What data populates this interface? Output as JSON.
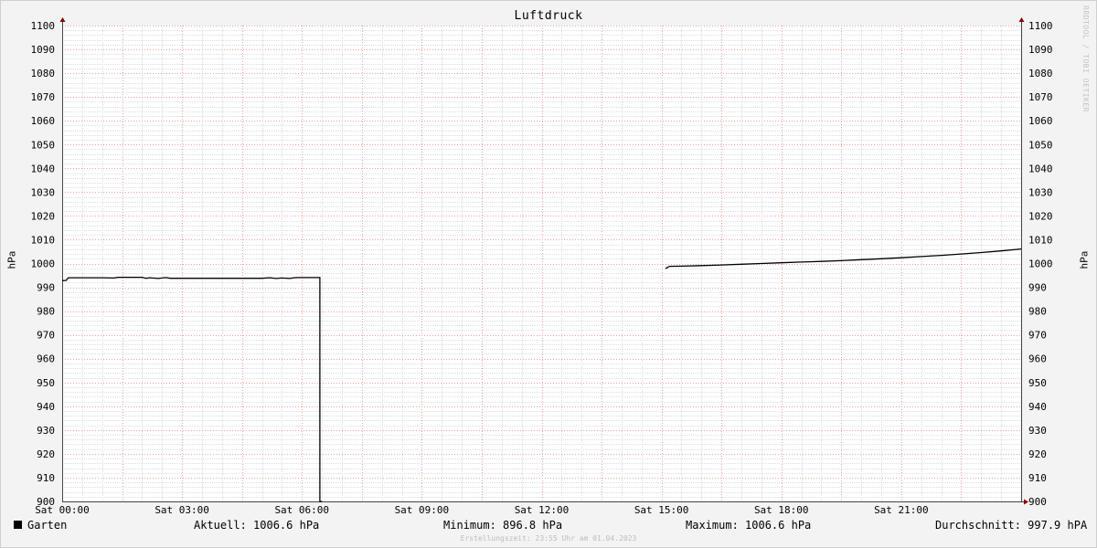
{
  "watermark": "RRDTOOL / TOBI OETIKER",
  "chart_data": {
    "type": "line",
    "title": "Luftdruck",
    "ylabel": "hPa",
    "ylim": [
      900,
      1100
    ],
    "ytick_labels": [
      "900",
      "910",
      "920",
      "930",
      "940",
      "950",
      "960",
      "970",
      "980",
      "990",
      "1000",
      "1010",
      "1020",
      "1030",
      "1040",
      "1050",
      "1060",
      "1070",
      "1080",
      "1090",
      "1100"
    ],
    "xlim": [
      0,
      24
    ],
    "xtick_labels": [
      "Sat 00:00",
      "Sat 03:00",
      "Sat 06:00",
      "Sat 09:00",
      "Sat 12:00",
      "Sat 15:00",
      "Sat 18:00",
      "Sat 21:00"
    ],
    "xtick_values": [
      0,
      3,
      6,
      9,
      12,
      15,
      18,
      21
    ],
    "grid": true,
    "series": [
      {
        "name": "Garten",
        "color": "#000000",
        "segments": [
          [
            [
              0.0,
              992.8
            ],
            [
              0.1,
              992.9
            ],
            [
              0.15,
              994.0
            ],
            [
              1.0,
              994.0
            ],
            [
              1.3,
              993.9
            ],
            [
              1.4,
              994.2
            ],
            [
              2.0,
              994.2
            ],
            [
              2.1,
              993.8
            ],
            [
              2.2,
              994.0
            ],
            [
              2.4,
              993.7
            ],
            [
              2.6,
              994.1
            ],
            [
              2.7,
              993.8
            ],
            [
              3.0,
              993.8
            ],
            [
              4.0,
              993.8
            ],
            [
              5.0,
              993.8
            ],
            [
              5.2,
              994.0
            ],
            [
              5.35,
              993.7
            ],
            [
              5.5,
              993.9
            ],
            [
              5.7,
              993.7
            ],
            [
              5.8,
              994.0
            ],
            [
              5.9,
              994.1
            ],
            [
              6.45,
              994.1
            ],
            [
              6.45,
              900.0
            ],
            [
              6.5,
              900.0
            ]
          ],
          [
            [
              15.1,
              997.9
            ],
            [
              15.2,
              998.8
            ],
            [
              15.5,
              998.9
            ],
            [
              16.0,
              999.1
            ],
            [
              16.5,
              999.4
            ],
            [
              17.0,
              999.7
            ],
            [
              17.5,
              1000.0
            ],
            [
              18.0,
              1000.3
            ],
            [
              18.5,
              1000.6
            ],
            [
              19.0,
              1000.9
            ],
            [
              19.5,
              1001.2
            ],
            [
              20.0,
              1001.6
            ],
            [
              20.5,
              1002.0
            ],
            [
              21.0,
              1002.4
            ],
            [
              21.5,
              1002.9
            ],
            [
              22.0,
              1003.4
            ],
            [
              22.5,
              1004.0
            ],
            [
              23.0,
              1004.6
            ],
            [
              23.5,
              1005.3
            ],
            [
              24.0,
              1006.1
            ]
          ]
        ]
      }
    ]
  },
  "legend": {
    "series_name": "Garten",
    "current": "Aktuell: 1006.6 hPa",
    "minimum": "Minimum: 896.8 hPa",
    "maximum": "Maximum: 1006.6 hPa",
    "average": "Durchschnitt: 997.9 hPA"
  },
  "footer": "Erstellungszeit: 23:55 Uhr am 01.04.2023"
}
